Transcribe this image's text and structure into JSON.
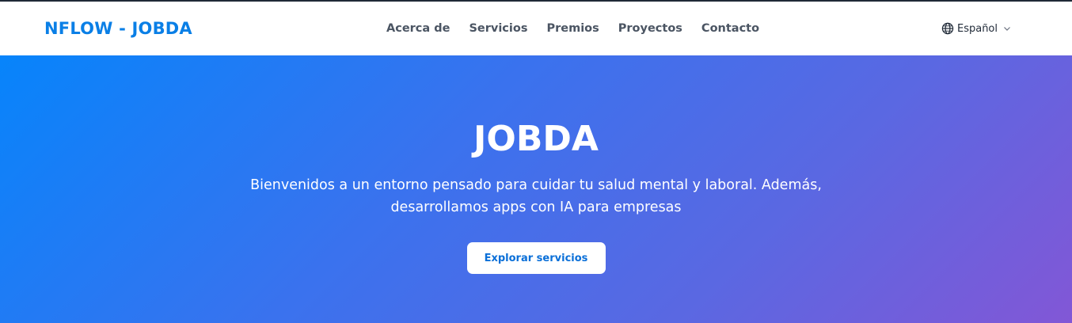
{
  "header": {
    "brand": "NFLOW - JOBDA",
    "nav": [
      {
        "label": "Acerca de"
      },
      {
        "label": "Servicios"
      },
      {
        "label": "Premios"
      },
      {
        "label": "Proyectos"
      },
      {
        "label": "Contacto"
      }
    ],
    "language": {
      "icon": "globe-icon",
      "label": "Español",
      "chevron_icon": "chevron-down-icon"
    }
  },
  "hero": {
    "title": "JOBDA",
    "subtitle_line1": "Bienvenidos a un entorno pensado para cuidar tu salud mental y laboral. Además,",
    "subtitle_line2": "desarrollamos apps con IA para empresas",
    "cta_label": "Explorar servicios"
  },
  "colors": {
    "brand": "#0a7fe6",
    "nav_text": "#4b5563",
    "hero_gradient_start": "#0784fb",
    "hero_gradient_end": "#8257d6",
    "cta_text": "#0a6fd8"
  }
}
